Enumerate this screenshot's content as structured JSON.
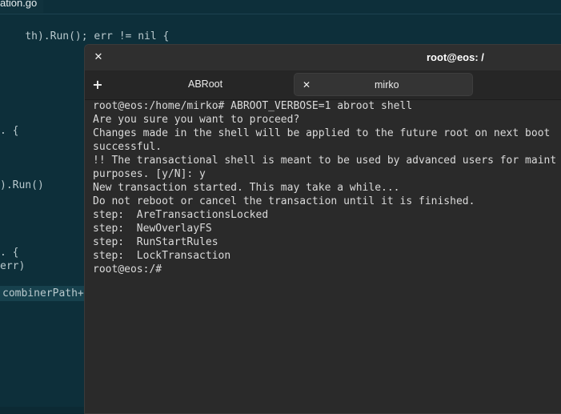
{
  "editor": {
    "tab_label": "ation.go",
    "lines": [
      "th).Run(); err != nil {",
      ". {",
      ").Run()",
      ". {",
      "err)",
      "combinerPath+"
    ],
    "keyword_nil": "nil"
  },
  "terminal": {
    "title": "root@eos: /",
    "tabs": [
      {
        "label": "ABRoot"
      },
      {
        "label": "mirko"
      }
    ],
    "lines": [
      "root@eos:/home/mirko# ABROOT_VERBOSE=1 abroot shell",
      "Are you sure you want to proceed?",
      "Changes made in the shell will be applied to the future root on next boot",
      "successful.",
      "!! The transactional shell is meant to be used by advanced users for maint",
      "purposes. [y/N]: y",
      "New transaction started. This may take a while...",
      "Do not reboot or cancel the transaction until it is finished.",
      "step:  AreTransactionsLocked",
      "step:  NewOverlayFS",
      "step:  RunStartRules",
      "step:  LockTransaction",
      "root@eos:/#"
    ]
  },
  "colors": {
    "editor_bg": "#0d2f3a",
    "terminal_bg": "#2a2a2a",
    "terminal_text": "#dadada"
  }
}
